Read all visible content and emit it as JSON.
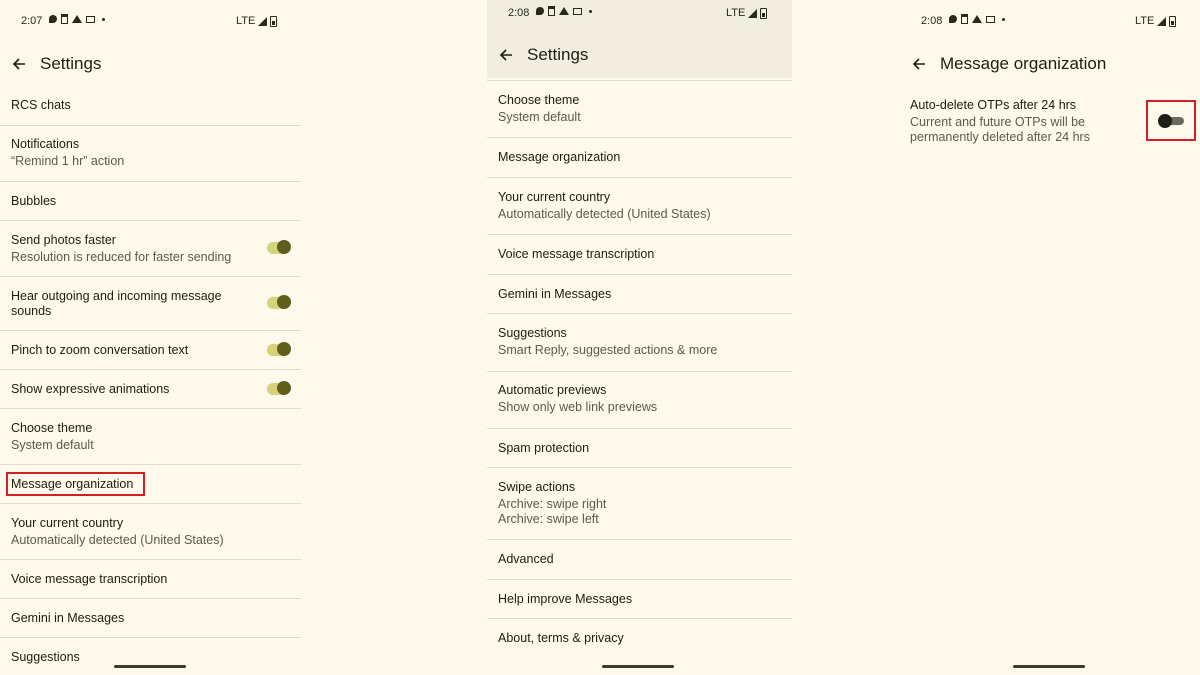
{
  "screens": [
    {
      "time": "2:07",
      "network": "LTE",
      "title": "Settings",
      "items": [
        {
          "title": "RCS chats",
          "subtitle": ""
        },
        {
          "title": "Notifications",
          "subtitle": "“Remind 1 hr” action"
        },
        {
          "title": "Bubbles",
          "subtitle": ""
        },
        {
          "title": "Send photos faster",
          "subtitle": "Resolution is reduced for faster sending"
        },
        {
          "title": "Hear outgoing and incoming message",
          "subtitle": "sounds"
        },
        {
          "title": "Pinch to zoom conversation text",
          "subtitle": ""
        },
        {
          "title": "Show expressive animations",
          "subtitle": ""
        },
        {
          "title": "Choose theme",
          "subtitle": "System default"
        },
        {
          "title": "Message organization",
          "subtitle": ""
        },
        {
          "title": "Your current country",
          "subtitle": "Automatically detected (United States)"
        },
        {
          "title": "Voice message transcription",
          "subtitle": ""
        },
        {
          "title": "Gemini in Messages",
          "subtitle": ""
        },
        {
          "title": "Suggestions",
          "subtitle": ""
        }
      ],
      "toggles": [
        {
          "item": "Send photos faster",
          "on": true
        },
        {
          "item": "Hear outgoing and incoming message sounds",
          "on": true
        },
        {
          "item": "Pinch to zoom conversation text",
          "on": true
        },
        {
          "item": "Show expressive animations",
          "on": true
        }
      ]
    },
    {
      "time": "2:08",
      "network": "LTE",
      "title": "Settings",
      "items": [
        {
          "title": "Choose theme",
          "subtitle": "System default"
        },
        {
          "title": "Message organization",
          "subtitle": ""
        },
        {
          "title": "Your current country",
          "subtitle": "Automatically detected (United States)"
        },
        {
          "title": "Voice message transcription",
          "subtitle": ""
        },
        {
          "title": "Gemini in Messages",
          "subtitle": ""
        },
        {
          "title": "Suggestions",
          "subtitle": "Smart Reply, suggested actions & more"
        },
        {
          "title": "Automatic previews",
          "subtitle": "Show only web link previews"
        },
        {
          "title": "Spam protection",
          "subtitle": ""
        },
        {
          "title": "Swipe actions",
          "subtitle": "Archive: swipe right",
          "subtitle2": "Archive: swipe left"
        },
        {
          "title": "Advanced",
          "subtitle": ""
        },
        {
          "title": "Help improve Messages",
          "subtitle": ""
        },
        {
          "title": "About, terms & privacy",
          "subtitle": ""
        }
      ]
    },
    {
      "time": "2:08",
      "network": "LTE",
      "title": "Message organization",
      "option": {
        "title": "Auto-delete OTPs after 24 hrs",
        "subtitle": "Current and future OTPs will be",
        "subtitle2": "permanently deleted after 24 hrs",
        "on": false
      }
    }
  ],
  "colors": {
    "background": "#fef9ea",
    "toggle_track_on": "#d5d27a",
    "toggle_knob_on": "#5f5e1c",
    "highlight": "#d11f26"
  }
}
